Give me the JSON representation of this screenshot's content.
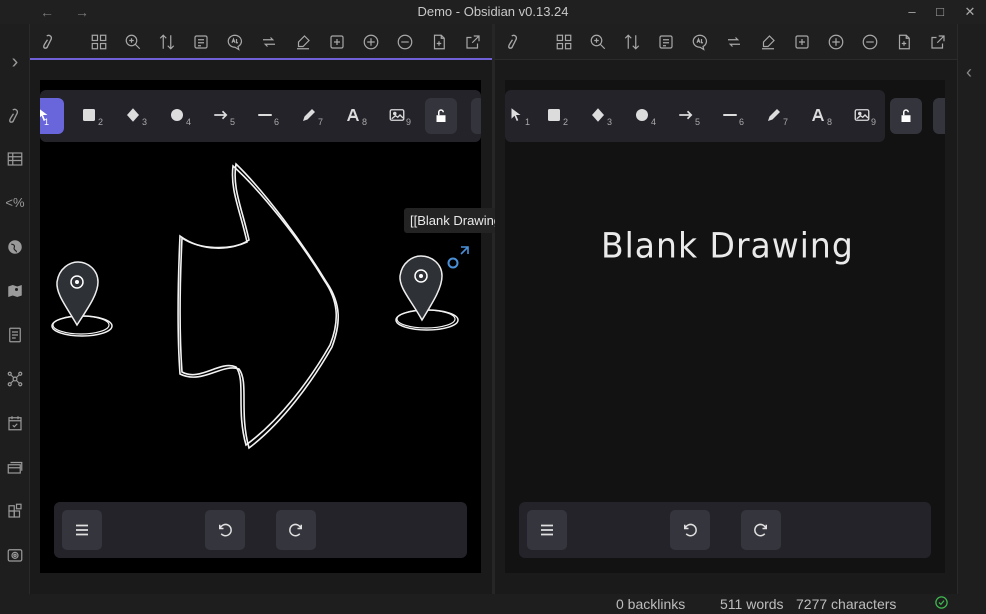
{
  "window": {
    "title": "Demo - Obsidian v0.13.24",
    "back_icon": "arrow-left-icon",
    "forward_icon": "arrow-right-icon",
    "minimize": "–",
    "maximize": "□",
    "close": "✕"
  },
  "ribbon": {
    "items": [
      "expand-icon",
      "excalidraw-icon",
      "table-icon",
      "templater-icon",
      "globe-icon",
      "map-icon",
      "note-icon",
      "graph-icon",
      "calendar-icon",
      "cards-icon",
      "plugins-icon",
      "camera-icon"
    ],
    "expand_glyph": "›",
    "templater_text": "<%"
  },
  "toolbar": {
    "tools": [
      {
        "name": "selection",
        "num": "1"
      },
      {
        "name": "rectangle",
        "num": "2"
      },
      {
        "name": "diamond",
        "num": "3"
      },
      {
        "name": "ellipse",
        "num": "4"
      },
      {
        "name": "arrow",
        "num": "5"
      },
      {
        "name": "line",
        "num": "6"
      },
      {
        "name": "draw",
        "num": "7"
      },
      {
        "name": "text",
        "num": "8"
      },
      {
        "name": "image",
        "num": "9"
      }
    ]
  },
  "left_pane": {
    "tooltip": "[[Blank Drawing]]"
  },
  "right_pane": {
    "title": "Blank Drawing"
  },
  "status": {
    "backlinks": "0 backlinks",
    "words": "511 words",
    "characters": "7277 characters"
  },
  "colors": {
    "accent": "#6965db",
    "canvas_left": "#000000",
    "canvas_right": "#121212",
    "sync_ok": "#3fb950"
  }
}
